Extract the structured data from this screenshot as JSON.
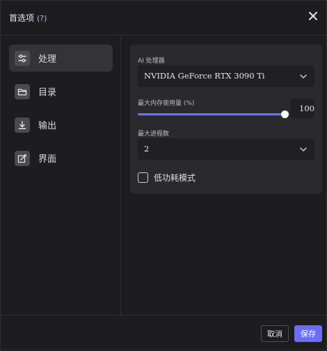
{
  "dialog": {
    "title": "首选项",
    "help": "(?)"
  },
  "sidebar": {
    "items": [
      {
        "label": "处理",
        "icon": "sliders-icon",
        "active": true
      },
      {
        "label": "目录",
        "icon": "folder-icon",
        "active": false
      },
      {
        "label": "输出",
        "icon": "download-icon",
        "active": false
      },
      {
        "label": "界面",
        "icon": "edit-icon",
        "active": false
      }
    ]
  },
  "processing": {
    "ai_processor_label": "AI 处理器",
    "ai_processor_value": "NVIDIA GeForce RTX 3090 Ti",
    "max_memory_label": "最大内存使用量 (%)",
    "max_memory_value": "100",
    "max_memory_fraction": 1.0,
    "max_threads_label": "最大进程数",
    "max_threads_value": "2",
    "low_power_label": "低功耗模式",
    "low_power_checked": false
  },
  "footer": {
    "cancel_label": "取消",
    "save_label": "保存"
  },
  "colors": {
    "accent": "#6b6ef5",
    "background": "#1d1d1f",
    "panel": "#2a2a2d"
  }
}
